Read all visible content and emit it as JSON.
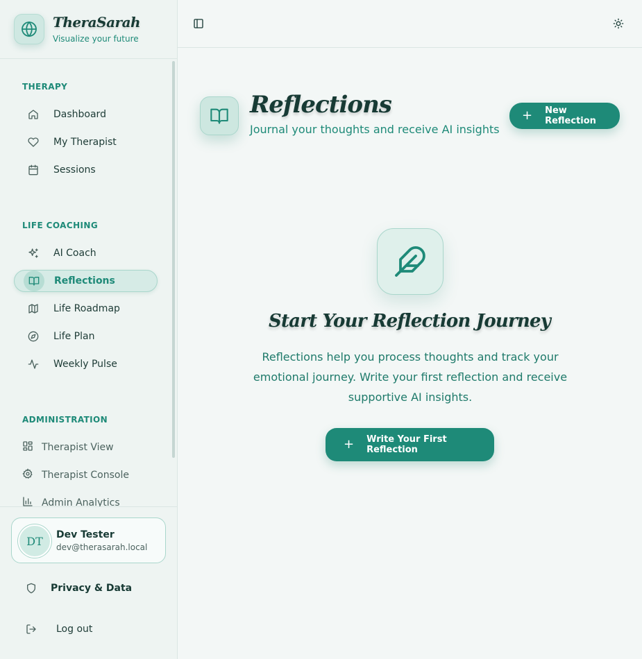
{
  "brand": {
    "title": "TheraSarah",
    "subtitle": "Visualize your future"
  },
  "sidebar": {
    "sections": [
      {
        "label": "THERAPY",
        "items": [
          {
            "label": "Dashboard",
            "icon": "home-icon"
          },
          {
            "label": "My Therapist",
            "icon": "heart-icon"
          },
          {
            "label": "Sessions",
            "icon": "calendar-icon"
          }
        ]
      },
      {
        "label": "LIFE COACHING",
        "items": [
          {
            "label": "AI Coach",
            "icon": "sparkles-icon"
          },
          {
            "label": "Reflections",
            "icon": "book-open-icon",
            "active": true
          },
          {
            "label": "Life Roadmap",
            "icon": "map-icon"
          },
          {
            "label": "Life Plan",
            "icon": "compass-icon"
          },
          {
            "label": "Weekly Pulse",
            "icon": "activity-icon"
          }
        ]
      },
      {
        "label": "ADMINISTRATION",
        "items": [
          {
            "label": "Therapist View",
            "icon": "layout-grid-icon"
          },
          {
            "label": "Therapist Console",
            "icon": "settings-icon"
          },
          {
            "label": "Admin Analytics",
            "icon": "bar-chart-icon"
          }
        ]
      }
    ]
  },
  "user": {
    "initials": "DT",
    "name": "Dev Tester",
    "email": "dev@therasarah.local"
  },
  "footer": {
    "privacy_label": "Privacy & Data",
    "logout_label": "Log out"
  },
  "header": {
    "title": "Reflections",
    "subtitle": "Journal your thoughts and receive AI insights",
    "new_button": "New Reflection"
  },
  "empty_state": {
    "title": "Start Your Reflection Journey",
    "text": "Reflections help you process thoughts and track your emotional journey. Write your first reflection and receive supportive AI insights.",
    "button": "Write Your First Reflection"
  },
  "colors": {
    "accent": "#1e8a78",
    "background": "#f3f7f6",
    "heading": "#173a34"
  }
}
